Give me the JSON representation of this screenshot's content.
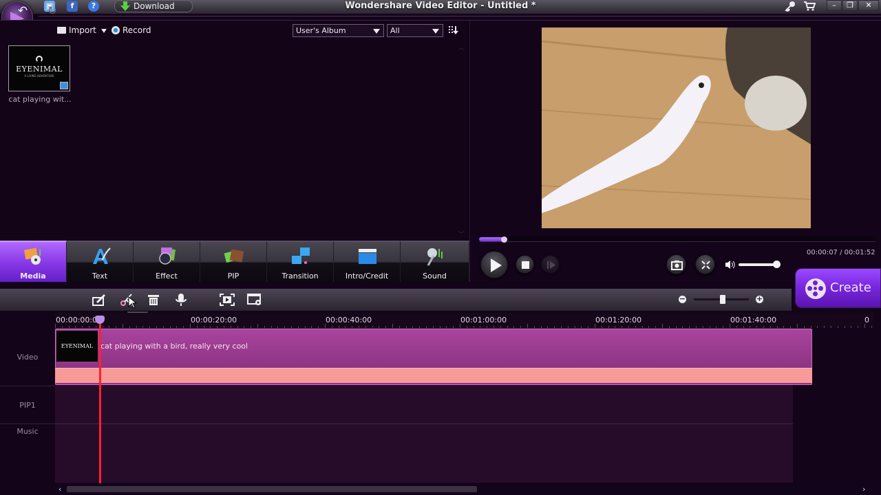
{
  "window": {
    "title": "Wondershare Video Editor - Untitled *",
    "download_label": "Download",
    "icons": [
      "save-icon",
      "facebook-icon",
      "help-icon",
      "key-icon",
      "cart-icon",
      "minimize-icon",
      "restore-icon",
      "close-icon"
    ]
  },
  "media": {
    "import_label": "Import",
    "record_label": "Record",
    "album_select": "User's Album",
    "filter_select": "All",
    "items": [
      {
        "name": "cat playing wit...",
        "thumb_brand": "EYENIMAL",
        "thumb_sub": "A LIVING ADVENTURE"
      }
    ]
  },
  "categories": [
    {
      "label": "Media",
      "icon": "media-icon",
      "active": true
    },
    {
      "label": "Text",
      "icon": "text-icon",
      "active": false
    },
    {
      "label": "Effect",
      "icon": "effect-icon",
      "active": false
    },
    {
      "label": "PIP",
      "icon": "pip-icon",
      "active": false
    },
    {
      "label": "Transition",
      "icon": "transition-icon",
      "active": false
    },
    {
      "label": "Intro/Credit",
      "icon": "intro-credit-icon",
      "active": false
    },
    {
      "label": "Sound",
      "icon": "sound-icon",
      "active": false
    }
  ],
  "player": {
    "current_time": "00:00:07",
    "total_time": "00:01:52",
    "time_readout": "00:00:07 / 00:01:52",
    "progress_fraction": 0.0625,
    "volume_fraction": 0.95
  },
  "create_label": "Create",
  "edit_toolbar": {
    "tooltip": "Split",
    "zoom_fraction": 0.5
  },
  "timeline": {
    "ruler_labels": [
      "00:00:00:00",
      "00:00:20:00",
      "00:00:40:00",
      "00:01:00:00",
      "00:01:20:00",
      "00:01:40:00",
      "0"
    ],
    "tracks": [
      "Video",
      "PIP1",
      "Music"
    ],
    "clip": {
      "title": "cat playing with a bird, really very cool",
      "thumb_brand": "EYENIMAL"
    }
  },
  "colors": {
    "accent": "#8a3ae8",
    "playhead": "#ff2030",
    "clip": "#a8449c",
    "audio_wave": "#f89a98"
  }
}
